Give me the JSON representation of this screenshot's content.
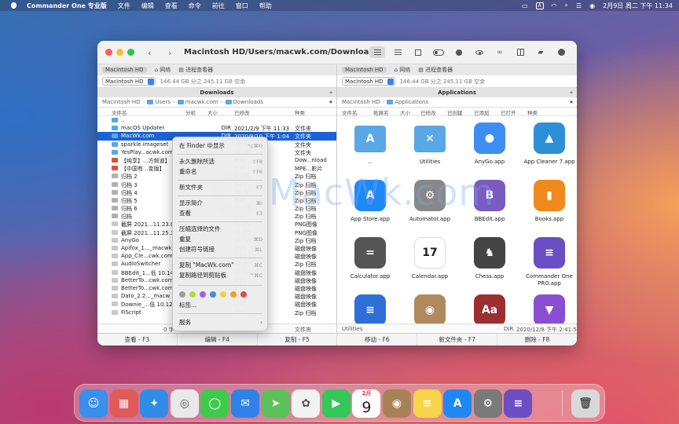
{
  "menubar": {
    "app_name": "Commander One 专业版",
    "items": [
      "文件",
      "编辑",
      "查看",
      "命令",
      "前往",
      "窗口",
      "帮助"
    ],
    "ime_label": "A",
    "datetime": "2月9日 周二 下午 11:34"
  },
  "window": {
    "back_icon": "chevron-left-icon",
    "forward_icon": "chevron-right-icon",
    "path_title": "Macintosh HD/Users/macwk.com/Downloads"
  },
  "left_panel": {
    "tabs": [
      "Macintosh HD",
      "网络",
      "进程查看器"
    ],
    "drive": "Macintosh HD",
    "space": "146.44 GB 分之 245.11 GB 空余",
    "folder_tab": "Downloads",
    "plus": "+",
    "breadcrumb": [
      "Macintosh HD",
      "Users",
      "macwk.com",
      "Downloads"
    ],
    "columns": [
      "文件名",
      "分机",
      "大小",
      "已修改",
      "种类"
    ],
    "rows": [
      {
        "icon": "folder",
        "name": "..",
        "size": "",
        "date": "",
        "kind": ""
      },
      {
        "icon": "folder",
        "name": "macOS Updater",
        "size": "DIR",
        "date": "2021/2/9 下午 11:33",
        "kind": "文件夹"
      },
      {
        "icon": "folder",
        "name": "MacWk.com",
        "size": "DIR",
        "date": "2020/8/10 下午 1:04",
        "kind": "文件夹",
        "selected": true
      },
      {
        "icon": "folder",
        "name": "sparkle.imageset",
        "size": "",
        "date": "12:53",
        "kind": "文件夹"
      },
      {
        "icon": "folder",
        "name": "YesPlay...acwk.com",
        "size": "",
        "date": "10:26",
        "kind": "文件夹"
      },
      {
        "icon": "red",
        "name": "【纯享】...方频道】",
        "size": "",
        "date": "9:41",
        "kind": "Dow...nload"
      },
      {
        "icon": "red",
        "name": "【中国有...变版】",
        "size": "",
        "date": "9:40",
        "kind": "MPE...影片"
      },
      {
        "icon": "zip",
        "name": "归档 2",
        "size": "",
        "date": "10:28",
        "kind": "Zip 归档"
      },
      {
        "icon": "zip",
        "name": "归档 3",
        "size": "",
        "date": "5:24",
        "kind": "Zip 归档"
      },
      {
        "icon": "zip",
        "name": "归档 4",
        "size": "",
        "date": "10:50",
        "kind": "Zip 归档"
      },
      {
        "icon": "zip",
        "name": "归档 5",
        "size": "",
        "date": "9:46",
        "kind": "Zip 归档"
      },
      {
        "icon": "zip",
        "name": "归档 6",
        "size": "",
        "date": "10:09",
        "kind": "Zip 归档"
      },
      {
        "icon": "zip",
        "name": "归档",
        "size": "",
        "date": "2:20",
        "kind": "Zip 归档"
      },
      {
        "icon": "file",
        "name": "截屏 2021...11.23.00",
        "size": "",
        "date": "11:23",
        "kind": "PNG图像"
      },
      {
        "icon": "file",
        "name": "截屏 2021...11.25.39",
        "size": "",
        "date": "11:25",
        "kind": "PNG图像"
      },
      {
        "icon": "file",
        "name": "AnyGo",
        "size": "",
        "date": "10:50",
        "kind": "Zip 归档"
      },
      {
        "icon": "file",
        "name": "Apifox_1..._macwk",
        "size": "",
        "date": "2:25",
        "kind": "磁盘映像"
      },
      {
        "icon": "file",
        "name": "App_Cle...cwk.com",
        "size": "",
        "date": "2:11",
        "kind": "磁盘映像"
      },
      {
        "icon": "file",
        "name": "AudioSwitcher",
        "size": "",
        "date": "10:35",
        "kind": "Zip 归档"
      },
      {
        "icon": "file",
        "name": "BBEdit_1...低 10.14.",
        "size": "",
        "date": "11:58",
        "kind": "磁盘映像"
      },
      {
        "icon": "file",
        "name": "BetterTo...cwk.com",
        "size": "",
        "date": "2:17",
        "kind": "磁盘映像"
      },
      {
        "icon": "file",
        "name": "BetterTo...cwk.com",
        "size": "",
        "date": "2:17",
        "kind": "磁盘映像"
      },
      {
        "icon": "file",
        "name": "Dato_2.2..._macw",
        "size": "",
        "date": "2:25",
        "kind": "磁盘映像"
      },
      {
        "icon": "file",
        "name": "Downie_...低 10.12.",
        "size": "",
        "date": "2:21",
        "kind": "磁盘映像"
      },
      {
        "icon": "file",
        "name": "FiScript",
        "size": "",
        "date": "10:51",
        "kind": "Zip 归档"
      }
    ],
    "footer_left": "0 字",
    "footer_right": "文件夹"
  },
  "right_panel": {
    "tabs": [
      "Macintosh HD",
      "网络",
      "进程查看器"
    ],
    "drive": "Macintosh HD",
    "space": "146.44 GB 分之 245.11 GB 空余",
    "folder_tab": "Applications",
    "plus": "+",
    "breadcrumb": [
      "Macintosh HD",
      "Applications"
    ],
    "columns": [
      "文件名",
      "拓展名",
      "大小",
      "已修改",
      "已创建",
      "已添加",
      "已打开",
      "种类"
    ],
    "apps": [
      {
        "name": "..",
        "icon": "folder-icon",
        "color": "#5aa7e6",
        "glyph": "A"
      },
      {
        "name": "Utilities",
        "icon": "folder-icon",
        "color": "#5aa7e6",
        "glyph": "✕"
      },
      {
        "name": "AnyGo.app",
        "icon": "map-pin-icon",
        "color": "#3d8ef0",
        "glyph": "●"
      },
      {
        "name": "App Cleaner 7.app",
        "icon": "mountain-icon",
        "color": "#2d8fd6",
        "glyph": "▲"
      },
      {
        "name": "App Store.app",
        "icon": "app-store-icon",
        "color": "#1e88f5",
        "glyph": "A"
      },
      {
        "name": "Automator.app",
        "icon": "robot-icon",
        "color": "#888888",
        "glyph": "⚙"
      },
      {
        "name": "BBEdit.app",
        "icon": "bbedit-icon",
        "color": "#7a5bbf",
        "glyph": "B"
      },
      {
        "name": "Books.app",
        "icon": "book-icon",
        "color": "#f08a1c",
        "glyph": "▮"
      },
      {
        "name": "Calculator.app",
        "icon": "calculator-icon",
        "color": "#555555",
        "glyph": "="
      },
      {
        "name": "Calendar.app",
        "icon": "calendar-icon",
        "color": "#ffffff",
        "glyph": "17"
      },
      {
        "name": "Chess.app",
        "icon": "chess-icon",
        "color": "#444444",
        "glyph": "♞"
      },
      {
        "name": "Commander One PRO.app",
        "icon": "commander-icon",
        "color": "#6b4ec4",
        "glyph": "≡"
      },
      {
        "name": "",
        "icon": "app-icon",
        "color": "#2d6fd6",
        "glyph": "≡"
      },
      {
        "name": "",
        "icon": "contacts-icon",
        "color": "#b08a5c",
        "glyph": "◉"
      },
      {
        "name": "",
        "icon": "dictionary-icon",
        "color": "#9c2f2f",
        "glyph": "Aa"
      },
      {
        "name": "",
        "icon": "app-icon",
        "color": "#8a4fd0",
        "glyph": "▼"
      }
    ],
    "footer_name": "Utilities",
    "footer_dir": "DIR",
    "footer_date": "2020/12/8 下午 2:41:56"
  },
  "fkeys": [
    "查看 - F3",
    "编辑 - F4",
    "复制 - F5",
    "移动 - F6",
    "新文件夹 - F7",
    "删除 - F8"
  ],
  "context_menu": {
    "items": [
      {
        "label": "在 Finder 中显示",
        "shortcut": "⌥⌘O"
      },
      {
        "label": "永久删除所选",
        "shortcut": "⇧F8"
      },
      {
        "label": "重命名",
        "shortcut": "⇧F6"
      },
      {
        "label": "新文件夹",
        "shortcut": "F7"
      },
      {
        "label": "显示简介",
        "shortcut": "⌘I"
      },
      {
        "label": "查看",
        "shortcut": "F3"
      },
      {
        "label": "压缩选择的文件",
        "shortcut": ""
      },
      {
        "label": "重复",
        "shortcut": "⌘D"
      },
      {
        "label": "创建符号链接",
        "shortcut": "⌘L"
      },
      {
        "label": "复制 \"MacWk.com\"",
        "shortcut": "⌘C"
      },
      {
        "label": "复制路径到剪贴板",
        "shortcut": "^⌘C"
      },
      {
        "label": "标签...",
        "shortcut": ""
      },
      {
        "label": "服务",
        "shortcut": ""
      }
    ],
    "tag_colors": [
      "#9e9e9e",
      "#b5d64a",
      "#a45fd4",
      "#3d8ef0",
      "#f0d23c",
      "#f0a030",
      "#e94a3c"
    ],
    "submenu_arrow": "›"
  },
  "watermark": "MacWk.com",
  "dock": {
    "calendar_month": "2月",
    "calendar_day": "9",
    "apps": [
      {
        "name": "finder-icon",
        "color": "#3a8fe8",
        "glyph": "☺"
      },
      {
        "name": "launchpad-icon",
        "color": "#e05a5a",
        "glyph": "▦"
      },
      {
        "name": "safari-icon",
        "color": "#2f8ce8",
        "glyph": "✦"
      },
      {
        "name": "chrome-icon",
        "color": "#e9e9e9",
        "glyph": "◎"
      },
      {
        "name": "messages-icon",
        "color": "#3ecb4b",
        "glyph": "◯"
      },
      {
        "name": "mail-icon",
        "color": "#2f82e8",
        "glyph": "✉"
      },
      {
        "name": "maps-icon",
        "color": "#5bc25b",
        "glyph": "➤"
      },
      {
        "name": "photos-icon",
        "color": "#f2f2f2",
        "glyph": "✿"
      },
      {
        "name": "facetime-icon",
        "color": "#34c759",
        "glyph": "▶"
      },
      {
        "name": "calendar-icon",
        "color": "#ffffff",
        "glyph": ""
      },
      {
        "name": "contacts-icon",
        "color": "#a88257",
        "glyph": "◉"
      },
      {
        "name": "notes-icon",
        "color": "#f7d44a",
        "glyph": "≡"
      },
      {
        "name": "app-store-icon",
        "color": "#1e88f5",
        "glyph": "A"
      },
      {
        "name": "system-preferences-icon",
        "color": "#7a7a7a",
        "glyph": "⚙"
      },
      {
        "name": "commander-one-icon",
        "color": "#6b4ec4",
        "glyph": "≡"
      },
      {
        "name": "trash-icon",
        "color": "#d8d8d8",
        "glyph": "🗑"
      }
    ]
  }
}
